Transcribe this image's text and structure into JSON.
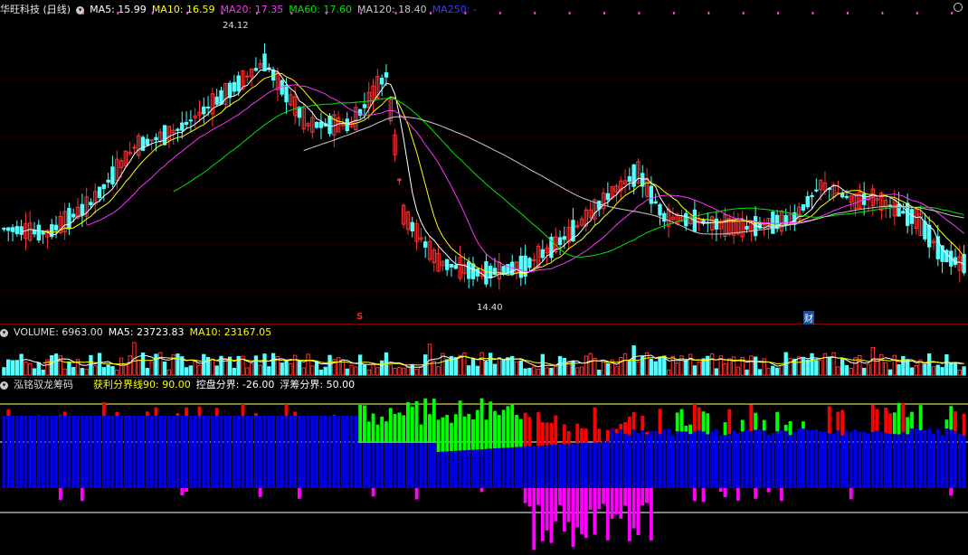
{
  "header_main": {
    "title": "华旺科技 (日线)",
    "ma5": "MA5: 15.99",
    "ma10": "MA10: 16.59",
    "ma20": "MA20: 17.35",
    "ma60": "MA60: 17.60",
    "ma120": "MA120: 18.40",
    "ma250": "MA250: -"
  },
  "header_volume": {
    "title": "VOLUME: 6963.00",
    "ma5": "MA5: 23723.83",
    "ma10": "MA10: 23167.05"
  },
  "header_indicator": {
    "title": "泓铭驭龙筹码",
    "profit_line": "获利分界线90: 90.00",
    "control": "控盘分界: -26.00",
    "float": "浮筹分界: 50.00"
  },
  "annotations": {
    "high": "24.12",
    "low": "14.40",
    "marker_s": "S",
    "marker_cai": "财"
  },
  "colors": {
    "up": "#ff3232",
    "down": "#54ffff",
    "ma5": "#ffffff",
    "ma10": "#ffff00",
    "ma20": "#ff32ff",
    "ma60": "#00e600",
    "ma120": "#c8c8c8",
    "ma250": "#3232ff",
    "chip_blue": "#0000e6",
    "chip_red": "#ff0000",
    "chip_green": "#00ff00",
    "chip_magenta": "#ff00ff"
  },
  "chart_data": {
    "type": "candlestick",
    "ylim": [
      13.5,
      25
    ],
    "ohlc_keypoints": [
      [
        0,
        16.8,
        17.2,
        16.3,
        16.5
      ],
      [
        10,
        16.2,
        16.9,
        16.0,
        16.7
      ],
      [
        20,
        17.2,
        18.3,
        17.0,
        18.1
      ],
      [
        30,
        19.6,
        20.6,
        19.3,
        20.2
      ],
      [
        40,
        20.5,
        21.1,
        19.9,
        20.7
      ],
      [
        50,
        21.6,
        22.6,
        21.3,
        22.2
      ],
      [
        60,
        23.4,
        24.12,
        22.8,
        23.2
      ],
      [
        70,
        21.0,
        21.4,
        20.2,
        20.6
      ],
      [
        80,
        20.7,
        21.2,
        20.4,
        20.9
      ],
      [
        88,
        22.6,
        23.3,
        22.2,
        23.0
      ],
      [
        92,
        17.0,
        18.0,
        16.8,
        17.4
      ],
      [
        100,
        15.2,
        15.8,
        15.0,
        15.4
      ],
      [
        110,
        14.8,
        15.4,
        14.4,
        14.9
      ],
      [
        120,
        15.0,
        15.5,
        14.7,
        15.3
      ],
      [
        130,
        16.2,
        16.9,
        16.0,
        16.6
      ],
      [
        140,
        17.8,
        18.8,
        17.5,
        18.4
      ],
      [
        146,
        18.6,
        19.9,
        18.2,
        19.2
      ],
      [
        152,
        17.2,
        17.8,
        16.6,
        17.0
      ],
      [
        160,
        16.9,
        17.3,
        16.7,
        17.0
      ],
      [
        170,
        16.6,
        17.0,
        16.3,
        16.7
      ],
      [
        182,
        16.7,
        17.6,
        16.5,
        17.4
      ],
      [
        188,
        18.2,
        19.0,
        17.8,
        18.6
      ],
      [
        196,
        17.6,
        18.2,
        17.3,
        17.9
      ],
      [
        200,
        17.9,
        18.2,
        17.6,
        17.9
      ],
      [
        210,
        17.2,
        17.5,
        16.6,
        16.9
      ],
      [
        216,
        15.7,
        16.4,
        15.3,
        15.6
      ],
      [
        220,
        15.0,
        15.6,
        15.0,
        15.5
      ]
    ],
    "ma_series": [
      "MA5",
      "MA10",
      "MA20",
      "MA60",
      "MA120"
    ],
    "volume": {
      "last": 6963.0,
      "ma5": 23723.83,
      "ma10": 23167.05
    },
    "indicator": {
      "profit_line": 90.0,
      "control_line": -26.0,
      "float_line": 50.0
    }
  }
}
